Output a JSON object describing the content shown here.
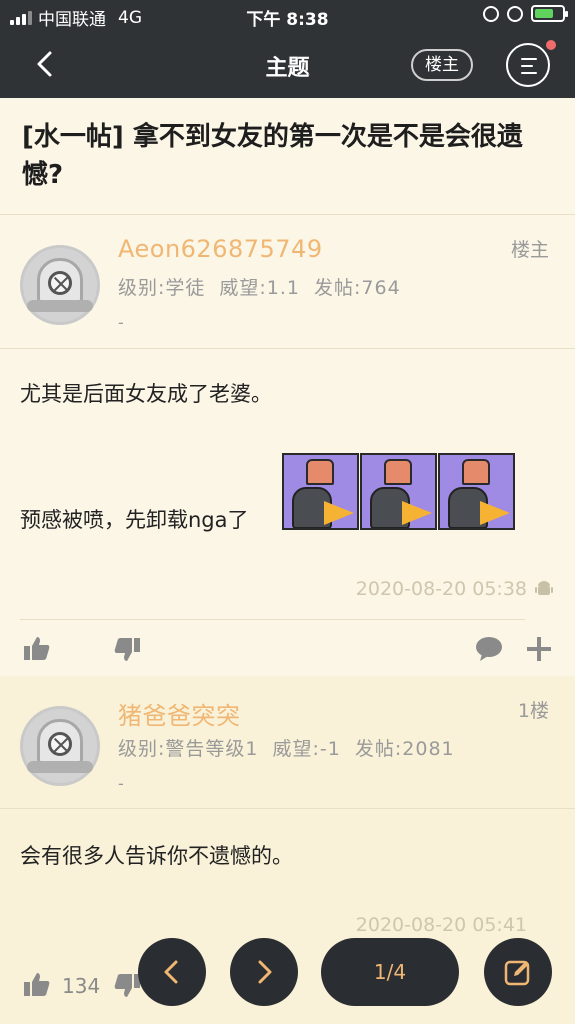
{
  "status_bar": {
    "carrier": "中国联通",
    "network": "4G",
    "time": "下午 8:38"
  },
  "nav": {
    "title": "主题",
    "op_filter": "楼主"
  },
  "topic": {
    "title": "[水一帖] 拿不到女友的第一次是不是会很遗憾?"
  },
  "posts": [
    {
      "username": "Aeon626875749",
      "level": "级别:学徒",
      "reputation": "威望:1.1",
      "post_count": "发帖:764",
      "signature": "-",
      "floor": "楼主",
      "content_line1": "尤其是后面女友成了老婆。",
      "content_line2": "预感被喷，先卸载nga了",
      "timestamp": "2020-08-20 05:38"
    },
    {
      "username": "猪爸爸突突",
      "level": "级别:警告等级1",
      "reputation": "威望:-1",
      "post_count": "发帖:2081",
      "signature": "-",
      "floor": "1楼",
      "content_line1": "会有很多人告诉你不遗憾的。",
      "timestamp": "2020-08-20 05:41",
      "likes": "134"
    }
  ],
  "pager": {
    "page": "1/4"
  },
  "colors": {
    "nav_bg": "#2f3335",
    "page_bg": "#fbf6e6",
    "username": "#f0b774",
    "meta": "#9a9a9a"
  }
}
